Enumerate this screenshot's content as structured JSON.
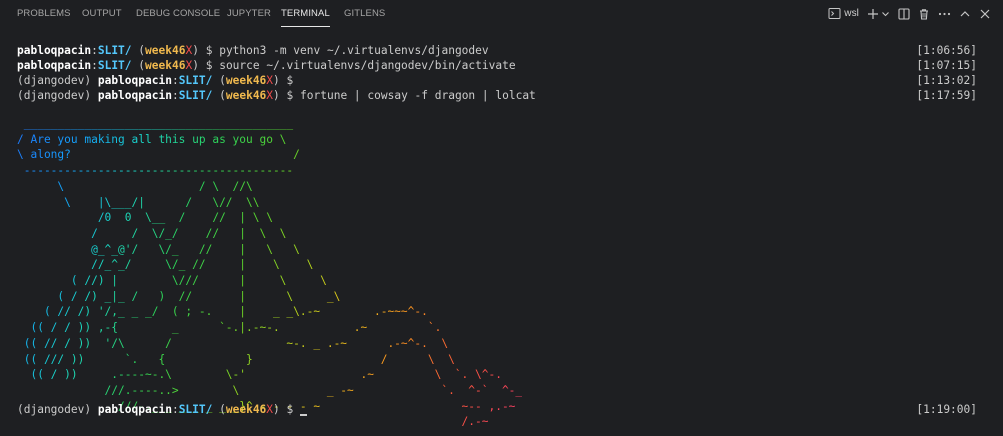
{
  "tabs": [
    {
      "label": "PROBLEMS",
      "active": false
    },
    {
      "label": "OUTPUT",
      "active": false
    },
    {
      "label": "DEBUG CONSOLE",
      "active": false
    },
    {
      "label": "JUPYTER",
      "active": false
    },
    {
      "label": "TERMINAL",
      "active": true
    },
    {
      "label": "GITLENS",
      "active": false
    }
  ],
  "toolbar": {
    "shell_name": "wsl",
    "icons": [
      "terminal-icon",
      "plus-icon",
      "chevron-down-icon",
      "split-icon",
      "trash-icon",
      "ellipsis-icon",
      "chevron-up-icon",
      "close-icon"
    ]
  },
  "prompt": {
    "venv": "(djangodev)",
    "user": "pabloqpacin",
    "sep": ":",
    "dir": "SLIT/",
    "branch": "week46",
    "dirty": "X",
    "symbol": "$"
  },
  "lines": [
    {
      "venv": "",
      "command": "python3 -m venv ~/.virtualenvs/djangodev",
      "time": "[1:06:56]"
    },
    {
      "venv": "",
      "command": "source ~/.virtualenvs/djangodev/bin/activate",
      "time": "[1:07:15]"
    },
    {
      "venv": "(djangodev)",
      "command": "",
      "time": "[1:13:02]"
    },
    {
      "venv": "(djangodev)",
      "command": "fortune | cowsay -f dragon | lolcat",
      "time": "[1:17:59]"
    }
  ],
  "output": {
    "art": " ________________________________________\n/ Are you making all this up as you go \\\n\\ along?                                 /\n ----------------------------------------\n      \\                    / \\  //\\\n       \\    |\\___/|      /   \\//  \\\\\n            /0  0  \\__  /    //  | \\ \\\n           /     /  \\/_/    //   |  \\  \\\n           @_^_@'/   \\/_   //    |   \\   \\\n           //_^_/     \\/_ //     |    \\    \\\n        ( //) |        \\///      |     \\     \\\n      ( / /) _|_ /   )  //       |      \\     _\\\n    ( // /) '/,_ _ _/  ( ; -.    |    _ _\\.-~        .-~~~^-.\n  (( / / )) ,-{        _      `-.|.-~-.           .~         `.\n (( // / ))  '/\\      /                 ~-. _ .-~      .-~^-.  \\\n (( /// ))      `.   {            }                   /      \\  \\\n  (( / ))     .----~-.\\        \\-'                 .~         \\  `. \\^-.\n             ///.----..>        \\             _ -~             `.  ^-`  ^-_\n               ///-._ _ _ _ _ _ _}^ - - - - ~                     ~-- ,.-~\n                                                                  /.-~"
  },
  "final": {
    "venv": "(djangodev)",
    "time": "[1:19:00]"
  }
}
